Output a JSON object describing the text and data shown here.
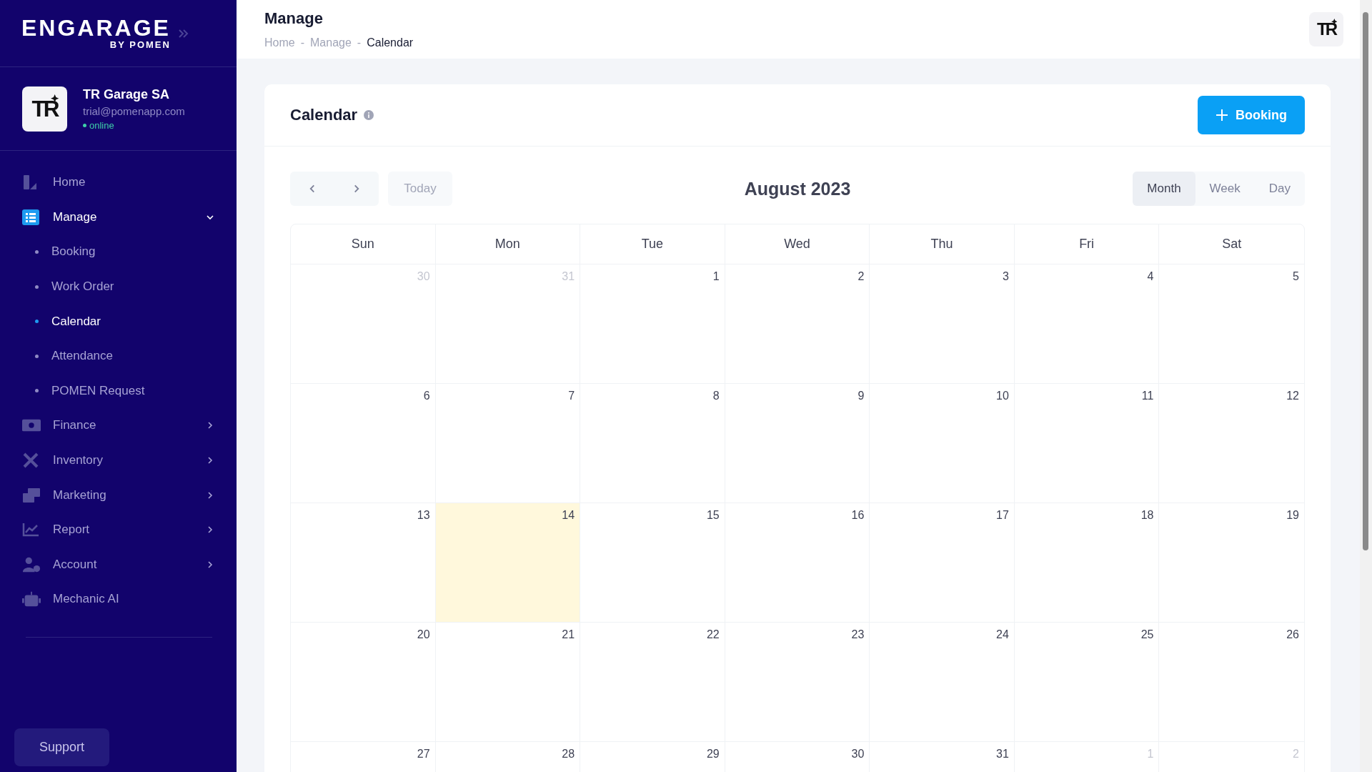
{
  "sidebar": {
    "logo": {
      "title": "ENGARAGE",
      "subtitle": "BY POMEN"
    },
    "profile": {
      "avatar_text": "TR",
      "name": "TR Garage SA",
      "email": "trial@pomenapp.com",
      "status": "online"
    },
    "menu": [
      {
        "label": "Home",
        "kind": "link",
        "selected": false
      },
      {
        "label": "Manage",
        "kind": "group",
        "selected": true,
        "expanded": true,
        "children": [
          {
            "label": "Booking",
            "selected": false
          },
          {
            "label": "Work Order",
            "selected": false
          },
          {
            "label": "Calendar",
            "selected": true
          },
          {
            "label": "Attendance",
            "selected": false
          },
          {
            "label": "POMEN Request",
            "selected": false
          }
        ]
      },
      {
        "label": "Finance",
        "kind": "group",
        "selected": false,
        "expanded": false
      },
      {
        "label": "Inventory",
        "kind": "group",
        "selected": false,
        "expanded": false
      },
      {
        "label": "Marketing",
        "kind": "group",
        "selected": false,
        "expanded": false
      },
      {
        "label": "Report",
        "kind": "group",
        "selected": false,
        "expanded": false
      },
      {
        "label": "Account",
        "kind": "group",
        "selected": false,
        "expanded": false
      },
      {
        "label": "Mechanic AI",
        "kind": "link",
        "selected": false
      }
    ],
    "support": "Support"
  },
  "header": {
    "title": "Manage",
    "breadcrumbs": [
      "Home",
      "Manage",
      "Calendar"
    ],
    "breadcrumb_separator": "-",
    "avatar_text": "TR"
  },
  "card": {
    "title": "Calendar",
    "add_button": "Booking",
    "today_button": "Today",
    "month_title": "August 2023",
    "views": [
      {
        "label": "Month",
        "selected": true
      },
      {
        "label": "Week",
        "selected": false
      },
      {
        "label": "Day",
        "selected": false
      }
    ],
    "weekdays": [
      "Sun",
      "Mon",
      "Tue",
      "Wed",
      "Thu",
      "Fri",
      "Sat"
    ],
    "weeks": [
      [
        {
          "day": "30",
          "other_month": true,
          "today": false
        },
        {
          "day": "31",
          "other_month": true,
          "today": false
        },
        {
          "day": "1",
          "other_month": false,
          "today": false
        },
        {
          "day": "2",
          "other_month": false,
          "today": false
        },
        {
          "day": "3",
          "other_month": false,
          "today": false
        },
        {
          "day": "4",
          "other_month": false,
          "today": false
        },
        {
          "day": "5",
          "other_month": false,
          "today": false
        }
      ],
      [
        {
          "day": "6",
          "other_month": false,
          "today": false
        },
        {
          "day": "7",
          "other_month": false,
          "today": false
        },
        {
          "day": "8",
          "other_month": false,
          "today": false
        },
        {
          "day": "9",
          "other_month": false,
          "today": false
        },
        {
          "day": "10",
          "other_month": false,
          "today": false
        },
        {
          "day": "11",
          "other_month": false,
          "today": false
        },
        {
          "day": "12",
          "other_month": false,
          "today": false
        }
      ],
      [
        {
          "day": "13",
          "other_month": false,
          "today": false
        },
        {
          "day": "14",
          "other_month": false,
          "today": true
        },
        {
          "day": "15",
          "other_month": false,
          "today": false
        },
        {
          "day": "16",
          "other_month": false,
          "today": false
        },
        {
          "day": "17",
          "other_month": false,
          "today": false
        },
        {
          "day": "18",
          "other_month": false,
          "today": false
        },
        {
          "day": "19",
          "other_month": false,
          "today": false
        }
      ],
      [
        {
          "day": "20",
          "other_month": false,
          "today": false
        },
        {
          "day": "21",
          "other_month": false,
          "today": false
        },
        {
          "day": "22",
          "other_month": false,
          "today": false
        },
        {
          "day": "23",
          "other_month": false,
          "today": false
        },
        {
          "day": "24",
          "other_month": false,
          "today": false
        },
        {
          "day": "25",
          "other_month": false,
          "today": false
        },
        {
          "day": "26",
          "other_month": false,
          "today": false
        }
      ],
      [
        {
          "day": "27",
          "other_month": false,
          "today": false
        },
        {
          "day": "28",
          "other_month": false,
          "today": false
        },
        {
          "day": "29",
          "other_month": false,
          "today": false
        },
        {
          "day": "30",
          "other_month": false,
          "today": false
        },
        {
          "day": "31",
          "other_month": false,
          "today": false
        },
        {
          "day": "1",
          "other_month": true,
          "today": false
        },
        {
          "day": "2",
          "other_month": true,
          "today": false
        }
      ]
    ]
  }
}
